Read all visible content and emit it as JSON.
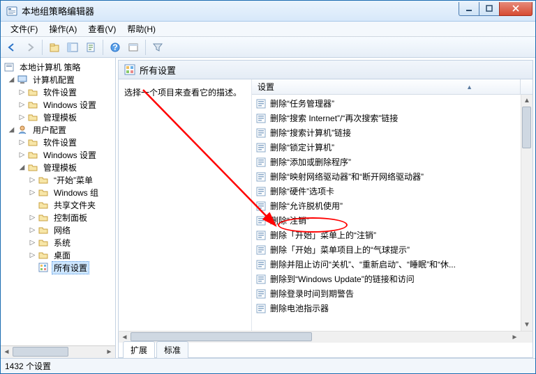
{
  "window": {
    "title": "本地组策略编辑器"
  },
  "menu": {
    "file": "文件(F)",
    "action": "操作(A)",
    "view": "查看(V)",
    "help": "帮助(H)"
  },
  "tree": {
    "root": "本地计算机 策略",
    "computer": "计算机配置",
    "c_software": "软件设置",
    "c_windows": "Windows 设置",
    "c_admin": "管理模板",
    "user": "用户配置",
    "u_software": "软件设置",
    "u_windows": "Windows 设置",
    "u_admin": "管理模板",
    "start_menu": "“开始”菜单",
    "windows_comp": "Windows 组",
    "shared": "共享文件夹",
    "control_panel": "控制面板",
    "network": "网络",
    "system": "系统",
    "desktop": "桌面",
    "all_settings": "所有设置"
  },
  "right": {
    "header": "所有设置",
    "description": "选择一个项目来查看它的描述。",
    "column": "设置"
  },
  "settings": [
    "删除“任务管理器”",
    "删除“搜索 Internet”/“再次搜索”链接",
    "删除“搜索计算机”链接",
    "删除“锁定计算机”",
    "删除“添加或删除程序”",
    "删除“映射网络驱动器”和“断开网络驱动器”",
    "删除“硬件”选项卡",
    "删除“允许脱机使用”",
    "删除“注销”",
    "删除「开始」菜单上的“注销”",
    "删除「开始」菜单项目上的“气球提示”",
    "删除并阻止访问“关机”、“重新启动”、“睡眠”和“休...",
    "删除到“Windows Update”的链接和访问",
    "删除登录时间到期警告",
    "删除电池指示器"
  ],
  "tabs": {
    "extended": "扩展",
    "standard": "标准"
  },
  "status": "1432 个设置"
}
